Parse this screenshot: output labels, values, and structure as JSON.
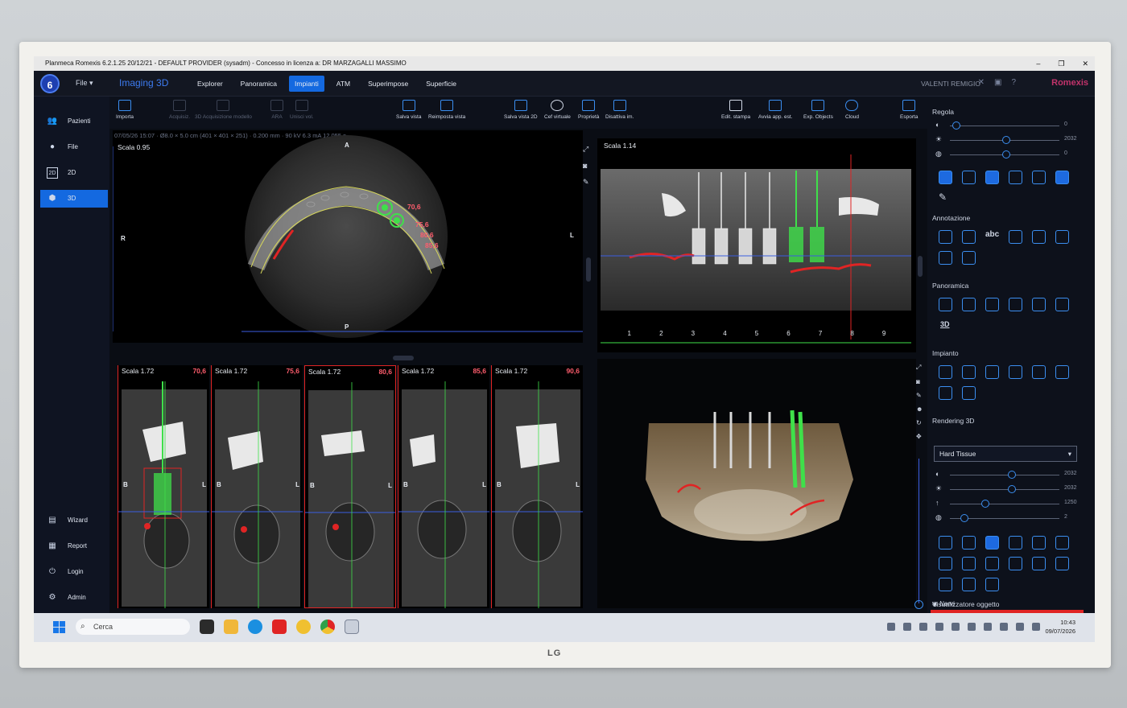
{
  "window": {
    "title": "Planmeca Romexis 6.2.1.25 20/12/21 - DEFAULT PROVIDER (sysadm) - Concesso in licenza a: DR MARZAGALLI MASSIMO"
  },
  "header": {
    "logo": "6",
    "file_menu": "File",
    "app_title": "Imaging 3D",
    "tabs": [
      "Explorer",
      "Panoramica",
      "Impianti",
      "ATM",
      "Superimpose",
      "Superficie"
    ],
    "active_tab": "Impianti",
    "user": "VALENTI REMIGIO",
    "brand": "Romexis"
  },
  "sidebar": {
    "items": [
      {
        "label": "Pazienti",
        "icon": "patients-icon"
      },
      {
        "label": "File",
        "icon": "user-icon"
      },
      {
        "label": "2D",
        "icon": "2d-icon"
      },
      {
        "label": "3D",
        "icon": "3d-cube-icon"
      }
    ],
    "active": "3D",
    "bottom_items": [
      {
        "label": "Wizard",
        "icon": "wizard-icon"
      },
      {
        "label": "Report",
        "icon": "report-icon"
      },
      {
        "label": "Login",
        "icon": "login-icon"
      },
      {
        "label": "Admin",
        "icon": "admin-icon"
      }
    ]
  },
  "toolbar": {
    "import": "Importa",
    "acquire": "Acquisiz.",
    "acquire_3d": "3D Acquisizione modello",
    "ara": "ARA",
    "merge": "Unisci vol.",
    "save_view": "Salva vista",
    "restore_view": "Reimposta vista",
    "save_2d": "Salva vista 2D",
    "ceph": "Cef virtuale",
    "properties": "Proprietà",
    "disable": "Disattiva im.",
    "edit_print": "Edit. stampa",
    "launch_app": "Avvia app. est.",
    "exp_objects": "Exp. Objects",
    "cloud": "Cloud",
    "export": "Esporta"
  },
  "viewports": {
    "axial": {
      "scale": "Scala 0.95",
      "info": "07/05/26 15:07 · Ø8.0 × 5.0 cm (401 × 401 × 251) · 0.200 mm · 90 kV 6.3 mA 12.055 s",
      "orient_top": "A",
      "orient_bottom": "P",
      "orient_left": "R",
      "orient_right": "L",
      "markers": [
        "70,6",
        "75,6",
        "80,6",
        "85,6"
      ]
    },
    "panoramic": {
      "scale": "Scala 1.14",
      "ruler": [
        "1",
        "2",
        "3",
        "4",
        "5",
        "6",
        "7",
        "8",
        "9"
      ]
    },
    "cross_sections": [
      {
        "scale": "Scala 1.72",
        "position": "70,6",
        "left": "B",
        "right": "L"
      },
      {
        "scale": "Scala 1.72",
        "position": "75,6",
        "left": "B",
        "right": "L"
      },
      {
        "scale": "Scala 1.72",
        "position": "80,6",
        "left": "B",
        "right": "L"
      },
      {
        "scale": "Scala 1.72",
        "position": "85,6",
        "left": "B",
        "right": "L"
      },
      {
        "scale": "Scala 1.72",
        "position": "90,6",
        "left": "B",
        "right": "L"
      }
    ]
  },
  "right_panel": {
    "regola": {
      "title": "Regola",
      "sliders": [
        {
          "glyph": "◐",
          "value": "0",
          "level": 0.02
        },
        {
          "glyph": "☀",
          "value": "2032",
          "level": 0.5
        },
        {
          "glyph": "◍",
          "value": "0",
          "level": 0.5
        }
      ]
    },
    "annotazione": "Annotazione",
    "annotazione_abc": "abc",
    "panoramica": "Panoramica",
    "panoramica_3d": "3D",
    "impianto": "Impianto",
    "rendering": {
      "title": "Rendering 3D",
      "preset": "Hard Tissue",
      "sliders": [
        {
          "glyph": "◐",
          "value": "2032",
          "level": 0.55
        },
        {
          "glyph": "☀",
          "value": "2032",
          "level": 0.55
        },
        {
          "glyph": "↑",
          "value": "1250",
          "level": 0.3
        },
        {
          "glyph": "◍",
          "value": "2",
          "level": 0.1
        }
      ]
    },
    "visualizer": {
      "title": "Visualizzatore oggetto",
      "item": "Nervi"
    }
  },
  "taskbar": {
    "search": "Cerca",
    "time": "10:43",
    "date": "09/07/2026"
  },
  "monitor_brand": "LG",
  "colors": {
    "accent": "#1469e0",
    "implant_green": "#3fe04a",
    "nerve_red": "#e02424",
    "brand": "#c2336b"
  }
}
